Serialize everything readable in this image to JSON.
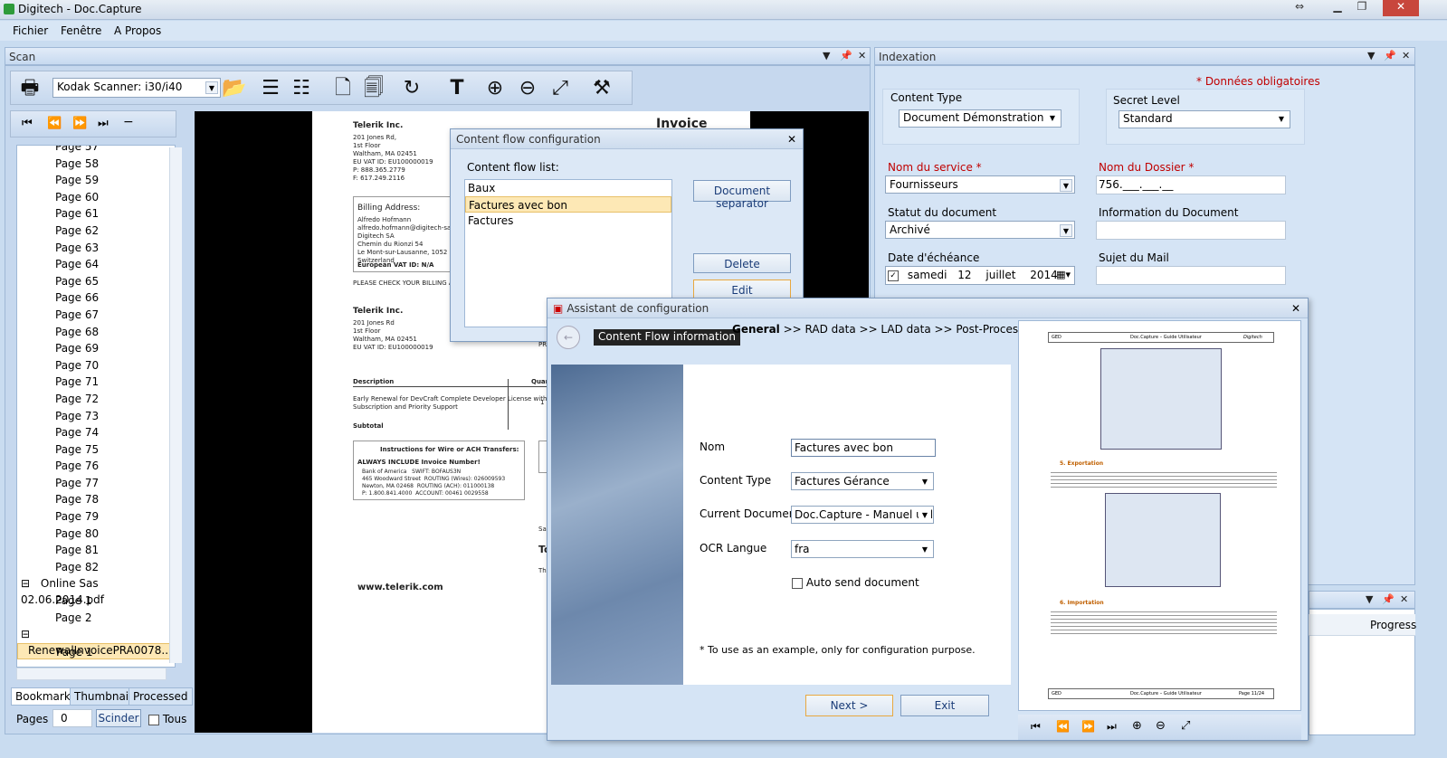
{
  "window": {
    "title": "Digitech - Doc.Capture"
  },
  "menu": [
    "Fichier",
    "Fenêtre",
    "A Propos"
  ],
  "scan_panel": {
    "title": "Scan",
    "scanner": "Kodak Scanner: i30/i40",
    "pages": [
      "Page 57",
      "Page 58",
      "Page 59",
      "Page 60",
      "Page 61",
      "Page 62",
      "Page 63",
      "Page 64",
      "Page 65",
      "Page 66",
      "Page 67",
      "Page 68",
      "Page 69",
      "Page 70",
      "Page 71",
      "Page 72",
      "Page 73",
      "Page 74",
      "Page 75",
      "Page 76",
      "Page 77",
      "Page 78",
      "Page 79",
      "Page 80",
      "Page 81",
      "Page 82"
    ],
    "group1": "Online Sas 02.06.2014.pdf",
    "group1_pages": [
      "Page 1",
      "Page 2"
    ],
    "group2": "RenewalInvoicePRA0078...",
    "group2_pages": [
      "Page 1"
    ],
    "tabs": [
      "Bookmarks",
      "Thumbnails",
      "Processed"
    ],
    "pages_label": "Pages",
    "pages_value": "0",
    "split_button": "Scinder",
    "all_label": "Tous"
  },
  "document": {
    "company": "Telerik Inc.",
    "address": "201 Jones Rd,\n1st Floor\nWaltham, MA 02451\nEU VAT ID: EU100000019\nP: 888.365.2779\nF: 617.249.2116",
    "billing_title": "Billing Address:",
    "billing": "Alfredo Hofmann\nalfredo.hofmann@digitech-sa.ch\nDigitech SA\nChemin du Rionzi 54\nLe Mont-sur-Lausanne, 1052\nSwitzerland",
    "vat": "European VAT ID: N/A",
    "check": "PLEASE CHECK YOUR BILLING AN",
    "company2": "Telerik Inc.",
    "address2": "201 Jones Rd\n1st Floor\nWaltham, MA 02451\nEU VAT ID: EU100000019",
    "desc_head": "Description",
    "qty_head": "Quan",
    "desc": "Early Renewal for DevCraft Complete Developer License with\nSubscription and Priority Support",
    "qty": "1",
    "subtotal": "Subtotal",
    "wire_title": "Instructions for Wire or ACH Transfers:",
    "wire_sub": "ALWAYS INCLUDE Invoice Number!",
    "wire_body": "Bank of America   SWIFT: BOFAUS3N\n465 Woodward Street  ROUTING (Wires): 026009593\nNewton, MA 02468  ROUTING (ACH): 011000138\nP: 1.800.841.4000  ACCOUNT: 00461 0029558",
    "website": "www.telerik.com",
    "invoice": "Invoice",
    "pr": "PR",
    "sa": "Sa",
    "to": "To",
    "the": "The"
  },
  "indexation": {
    "title": "Indexation",
    "mandatory": "* Données obligatoires",
    "content_type_label": "Content Type",
    "content_type": "Document Démonstration",
    "secret_label": "Secret Level",
    "secret": "Standard",
    "service_label": "Nom du service *",
    "service": "Fournisseurs",
    "dossier_label": "Nom du Dossier *",
    "dossier": "756.___.___.__",
    "statut_label": "Statut du document",
    "statut": "Archivé",
    "info_label": "Information du Document",
    "echeance_label": "Date d'échéance",
    "date_day": "samedi",
    "date_num": "12",
    "date_month": "juillet",
    "date_year": "2014",
    "mail_label": "Sujet du Mail"
  },
  "progress_panel": {
    "column": "Progress"
  },
  "flow_dialog": {
    "title": "Content flow configuration",
    "list_label": "Content flow list:",
    "items": [
      "Baux",
      "Factures avec bon",
      "Factures"
    ],
    "separator_btn": "Document separator",
    "delete_btn": "Delete",
    "edit_btn": "Edit"
  },
  "assistant": {
    "title": "Assistant de configuration",
    "tag": "Content Flow information",
    "steps_bold": "General",
    "steps": " >> RAD data >> LAD data >> Post-Process >> Done",
    "nom_label": "Nom",
    "nom": "Factures avec bon",
    "ct_label": "Content Type",
    "ct": "Factures Gérance",
    "cd_label": "Current Document *",
    "cd": "Doc.Capture - Manuel utilis",
    "ocr_label": "OCR Langue",
    "ocr": "fra",
    "auto_label": "Auto send document",
    "note": "* To use as an example, only for configuration purpose.",
    "next": "Next  >",
    "exit": "Exit",
    "preview": {
      "header_left": "GED",
      "header_mid": "Doc.Capture – Guide Utilisateur",
      "header_right": "Digitech",
      "sec5": "5.  Exportation",
      "sec6": "6.  Importation",
      "footer_left": "GED",
      "footer_mid": "Doc.Capture – Guide Utilisateur",
      "footer_right": "Page 11/24"
    }
  }
}
